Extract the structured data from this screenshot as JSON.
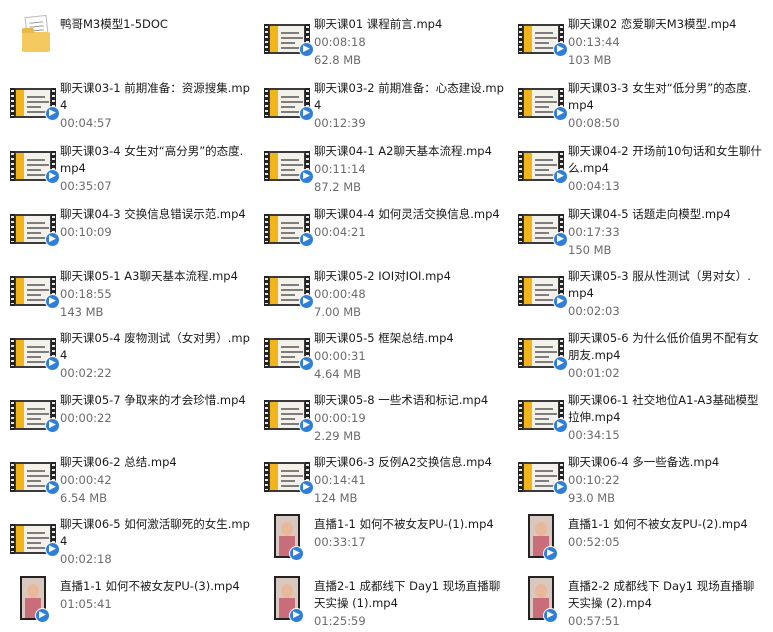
{
  "files": [
    {
      "name": "鸭哥M3模型1-5DOC",
      "duration": "",
      "size": "",
      "icon": "folder-icon"
    },
    {
      "name": "聊天课01 课程前言.mp4",
      "duration": "00:08:18",
      "size": "62.8 MB",
      "icon": "video-icon"
    },
    {
      "name": "聊天课02 恋爱聊天M3模型.mp4",
      "duration": "00:13:44",
      "size": "103 MB",
      "icon": "video-icon"
    },
    {
      "name": "聊天课03-1 前期准备：资源搜集.mp4",
      "duration": "00:04:57",
      "size": "",
      "icon": "video-icon"
    },
    {
      "name": "聊天课03-2 前期准备：心态建设.mp4",
      "duration": "00:12:39",
      "size": "",
      "icon": "video-icon"
    },
    {
      "name": "聊天课03-3 女生对“低分男”的态度.mp4",
      "duration": "00:08:50",
      "size": "",
      "icon": "video-icon"
    },
    {
      "name": "聊天课03-4 女生对“高分男”的态度.mp4",
      "duration": "00:35:07",
      "size": "",
      "icon": "video-icon"
    },
    {
      "name": "聊天课04-1 A2聊天基本流程.mp4",
      "duration": "00:11:14",
      "size": "87.2 MB",
      "icon": "video-icon"
    },
    {
      "name": "聊天课04-2 开场前10句话和女生聊什么.mp4",
      "duration": "00:04:13",
      "size": "",
      "icon": "video-icon"
    },
    {
      "name": "聊天课04-3 交换信息错误示范.mp4",
      "duration": "00:10:09",
      "size": "",
      "icon": "video-icon"
    },
    {
      "name": "聊天课04-4 如何灵活交换信息.mp4",
      "duration": "00:04:21",
      "size": "",
      "icon": "video-icon"
    },
    {
      "name": "聊天课04-5 话题走向模型.mp4",
      "duration": "00:17:33",
      "size": "150 MB",
      "icon": "video-icon"
    },
    {
      "name": "聊天课05-1 A3聊天基本流程.mp4",
      "duration": "00:18:55",
      "size": "143 MB",
      "icon": "video-icon"
    },
    {
      "name": "聊天课05-2 IOI对IOI.mp4",
      "duration": "00:00:48",
      "size": "7.00 MB",
      "icon": "video-icon"
    },
    {
      "name": "聊天课05-3 服从性测试（男对女）.mp4",
      "duration": "00:02:03",
      "size": "",
      "icon": "video-icon"
    },
    {
      "name": "聊天课05-4 废物测试（女对男）.mp4",
      "duration": "00:02:22",
      "size": "",
      "icon": "video-icon"
    },
    {
      "name": "聊天课05-5 框架总结.mp4",
      "duration": "00:00:31",
      "size": "4.64 MB",
      "icon": "video-icon"
    },
    {
      "name": "聊天课05-6 为什么低价值男不配有女朋友.mp4",
      "duration": "00:01:02",
      "size": "",
      "icon": "video-icon"
    },
    {
      "name": "聊天课05-7 争取来的才会珍惜.mp4",
      "duration": "00:00:22",
      "size": "",
      "icon": "video-icon"
    },
    {
      "name": "聊天课05-8 一些术语和标记.mp4",
      "duration": "00:00:19",
      "size": "2.29 MB",
      "icon": "video-icon"
    },
    {
      "name": "聊天课06-1 社交地位A1-A3基础模型拉伸.mp4",
      "duration": "00:34:15",
      "size": "",
      "icon": "video-icon"
    },
    {
      "name": "聊天课06-2 总结.mp4",
      "duration": "00:00:42",
      "size": "6.54 MB",
      "icon": "video-icon"
    },
    {
      "name": "聊天课06-3 反例A2交换信息.mp4",
      "duration": "00:14:41",
      "size": "124 MB",
      "icon": "video-icon"
    },
    {
      "name": "聊天课06-4 多一些备选.mp4",
      "duration": "00:10:22",
      "size": "93.0 MB",
      "icon": "video-icon"
    },
    {
      "name": "聊天课06-5 如何激活聊死的女生.mp4",
      "duration": "00:02:18",
      "size": "",
      "icon": "video-icon"
    },
    {
      "name": "直播1-1 如何不被女友PU-(1).mp4",
      "duration": "00:33:17",
      "size": "",
      "icon": "phone-video-icon"
    },
    {
      "name": "直播1-1 如何不被女友PU-(2).mp4",
      "duration": "00:52:05",
      "size": "",
      "icon": "phone-video-icon"
    },
    {
      "name": "直播1-1 如何不被女友PU-(3).mp4",
      "duration": "01:05:41",
      "size": "",
      "icon": "phone-video-icon"
    },
    {
      "name": "直播2-1 成都线下 Day1 现场直播聊天实操 (1).mp4",
      "duration": "01:25:59",
      "size": "",
      "icon": "phone-video-icon"
    },
    {
      "name": "直播2-2 成都线下 Day1 现场直播聊天实操 (2).mp4",
      "duration": "00:57:51",
      "size": "",
      "icon": "phone-video-icon"
    }
  ]
}
